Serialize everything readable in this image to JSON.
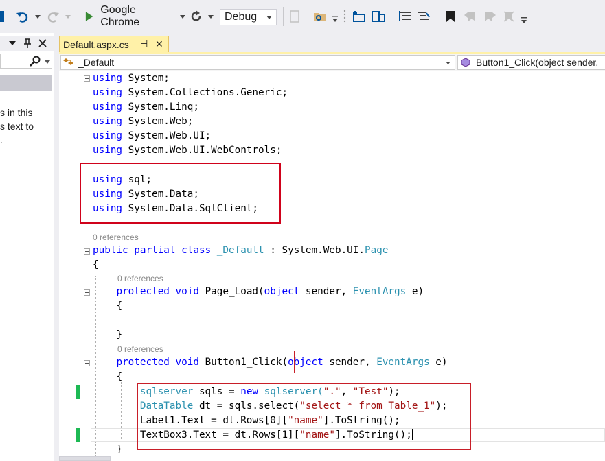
{
  "toolbar": {
    "run_target": "Google Chrome",
    "config": "Debug"
  },
  "left_panel": {
    "text_line1": "s in this",
    "text_line2": "s text to",
    "text_line3": "."
  },
  "tab": {
    "title": "Default.aspx.cs",
    "pin_glyph": "⊣",
    "close_glyph": "✕"
  },
  "navbar": {
    "class_combo": "_Default",
    "member_combo": "Button1_Click(object sender,"
  },
  "code": {
    "using1": "System;",
    "using2": "System.Collections.Generic;",
    "using3": "System.Linq;",
    "using4": "System.Web;",
    "using5": "System.Web.UI;",
    "using6": "System.Web.UI.WebControls;",
    "using7": "sql;",
    "using8": "System.Data;",
    "using9": "System.Data.SqlClient;",
    "kw_using": "using",
    "refs": "0 references",
    "kw_public": "public",
    "kw_partial": "partial",
    "kw_class": "class",
    "class_name": "_Default",
    "base_sep": ":",
    "base_ns": "System.Web.UI.",
    "base_type": "Page",
    "open_brace": "{",
    "close_brace": "}",
    "kw_protected": "protected",
    "kw_void": "void",
    "page_load": "Page_Load(",
    "kw_object": "object",
    "sender": "sender,",
    "event_args": "EventArgs",
    "e_close": "e)",
    "button_click": "Button1_Click",
    "paren_open": "(",
    "stmt1_type": "sqlserver",
    "stmt1_mid": "sqls =",
    "kw_new": "new",
    "stmt1_ctor": "sqlserver(",
    "stmt1_arg1": "\".\"",
    "comma": ",",
    "stmt1_arg2": "\"Test\"",
    "stmt_end": ");",
    "stmt2_type": "DataTable",
    "stmt2_mid": "dt = sqls.select(",
    "stmt2_arg": "\"select * from Table_1\"",
    "stmt3_a": "Label1.Text = dt.Rows[0][",
    "stmt3_key": "\"name\"",
    "stmt3_b": "].ToString();",
    "stmt4_a": "TextBox3.Text = dt.Rows[1][",
    "stmt4_key": "\"name\"",
    "stmt4_b": "].ToString();"
  },
  "colors": {
    "keyword": "#0000ff",
    "type": "#2b91af",
    "string": "#a31515",
    "annotation_red": "#d0021b",
    "changed_green": "#1db954"
  }
}
